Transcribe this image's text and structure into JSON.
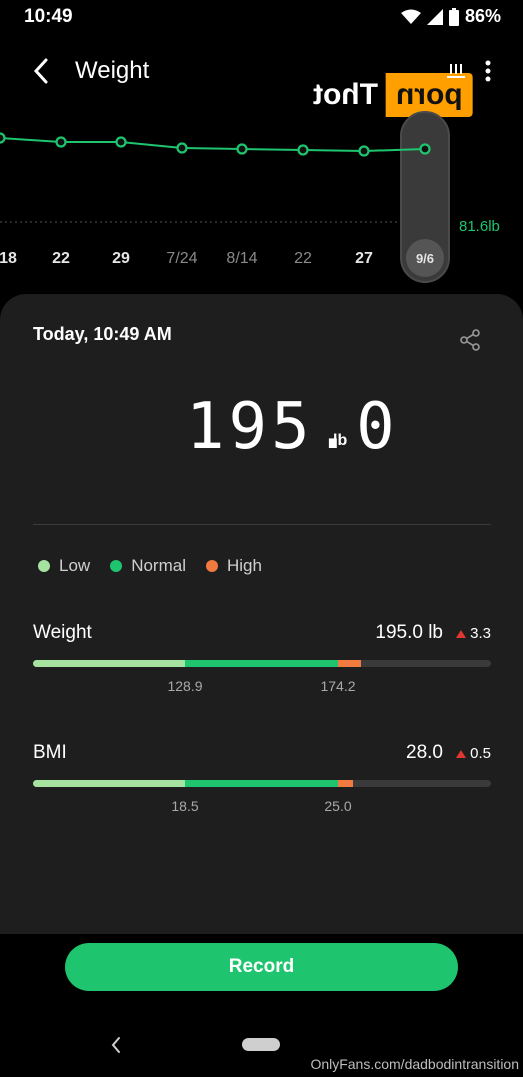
{
  "status": {
    "time": "10:49",
    "battery": "86%"
  },
  "header": {
    "title": "Weight"
  },
  "watermark": {
    "orange_text": "porn",
    "white_text": "Thot"
  },
  "trend": {
    "dates": [
      "18",
      "22",
      "29",
      "7/24",
      "8/14",
      "22",
      "27",
      "9/6"
    ],
    "dim_dates": [
      false,
      false,
      false,
      true,
      true,
      true,
      false,
      false
    ],
    "reference_label": "81.6lb",
    "point_offsets": [
      0,
      4,
      4,
      10,
      11,
      12,
      13,
      11
    ],
    "line_color": "#1fc56e"
  },
  "card": {
    "date": "Today, 10:49 AM",
    "value": "195.0",
    "unit": "lb"
  },
  "legend": [
    {
      "label": "Low",
      "color": "#a6e3a1"
    },
    {
      "label": "Normal",
      "color": "#1fc56e"
    },
    {
      "label": "High",
      "color": "#f07a40"
    }
  ],
  "metrics": [
    {
      "name": "Weight",
      "value": "195.0 lb",
      "delta": "3.3",
      "thresholds": [
        "128.9",
        "174.2"
      ],
      "segments": [
        0.333,
        0.667,
        0.716
      ],
      "marker": 0.716
    },
    {
      "name": "BMI",
      "value": "28.0",
      "delta": "0.5",
      "thresholds": [
        "18.5",
        "25.0"
      ],
      "segments": [
        0.333,
        0.667,
        0.7
      ],
      "marker": 0.7
    }
  ],
  "actions": {
    "record": "Record"
  },
  "footer": {
    "watermark": "OnlyFans.com/dadbodintransition"
  }
}
